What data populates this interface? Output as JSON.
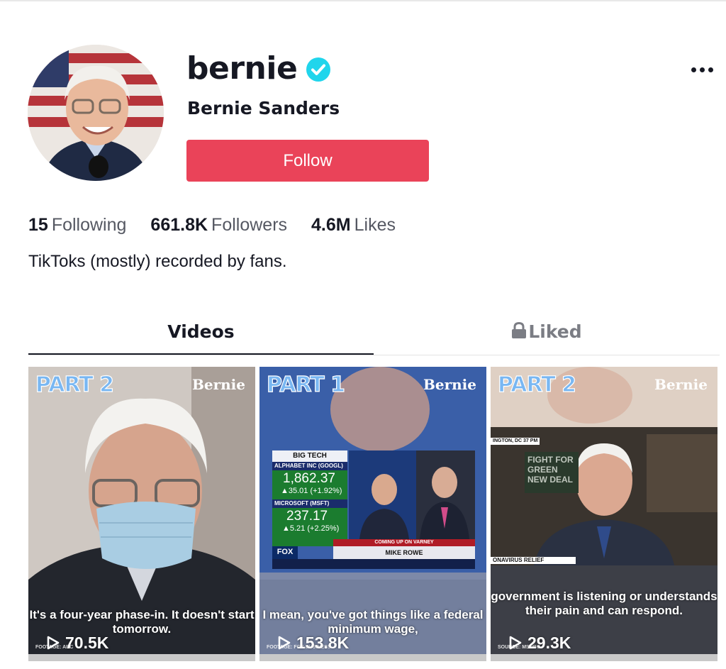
{
  "profile": {
    "username": "bernie",
    "display_name": "Bernie Sanders",
    "verified": true,
    "follow_label": "Follow",
    "more_icon": "more-horizontal-icon",
    "bio": "TikToks (mostly) recorded by fans.",
    "accent_color": "#ea4359",
    "verified_color": "#20d5ec"
  },
  "stats": [
    {
      "value": "15",
      "label": "Following"
    },
    {
      "value": "661.8K",
      "label": "Followers"
    },
    {
      "value": "4.6M",
      "label": "Likes"
    }
  ],
  "tabs": [
    {
      "label": "Videos",
      "active": true
    },
    {
      "label": "Liked",
      "active": false,
      "icon": "lock-icon"
    }
  ],
  "videos": [
    {
      "part": "PART 2",
      "brand": "Bernie",
      "caption": "It's a four-year phase-in. It doesn't start tomorrow.",
      "footage": "FOOTAGE: ABC",
      "views": "70.5K"
    },
    {
      "part": "PART 1",
      "brand": "Bernie",
      "caption": "I mean, you've got things like a federal minimum wage,",
      "footage": "FOOTAGE: FOX BUSINESS",
      "views": "153.8K",
      "fox": {
        "header": "BIG TECH",
        "stock1_name": "ALPHABET INC (GOOGL)",
        "stock1_value": "1,862.37",
        "stock1_change": "▲35.01 (+1.92%)",
        "stock2_name": "MICROSOFT (MSFT)",
        "stock2_value": "237.17",
        "stock2_change": "▲5.21 (+2.25%)",
        "coming_up": "COMING UP ON VARNEY",
        "guest": "MIKE ROWE",
        "logo": "FOX BUSINESS"
      }
    },
    {
      "part": "PART 2",
      "brand": "Bernie",
      "caption": "government is listening or understands their pain and can respond.",
      "footage": "SOURCE: MSNBC",
      "views": "29.3K",
      "dc_label": "INGTON, DC 37 PM",
      "relief_label": "ONAVIRUS RELIEF",
      "sign_text": "FIGHT FOR GREEN NEW DEAL"
    }
  ]
}
